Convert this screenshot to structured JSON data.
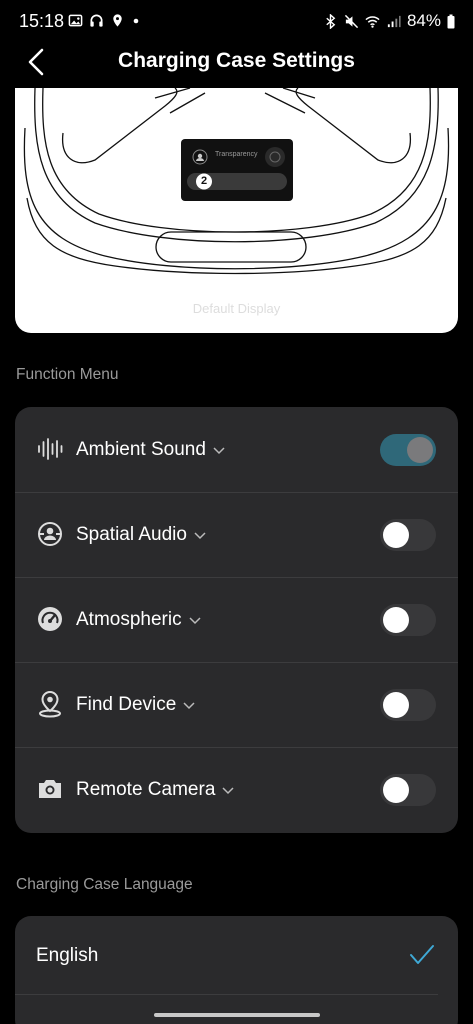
{
  "status_bar": {
    "time": "15:18",
    "battery": "84%"
  },
  "header": {
    "title": "Charging Case Settings"
  },
  "preview": {
    "screen_mode_label": "Transparency",
    "screen_badge": "2",
    "caption": "Default Display"
  },
  "function_menu": {
    "label": "Function Menu",
    "items": [
      {
        "label": "Ambient Sound",
        "icon": "waveform-icon",
        "enabled": true
      },
      {
        "label": "Spatial Audio",
        "icon": "spatial-audio-icon",
        "enabled": false
      },
      {
        "label": "Atmospheric",
        "icon": "gauge-icon",
        "enabled": false
      },
      {
        "label": "Find Device",
        "icon": "location-pin-icon",
        "enabled": false
      },
      {
        "label": "Remote Camera",
        "icon": "camera-icon",
        "enabled": false
      }
    ]
  },
  "language": {
    "label": "Charging Case Language",
    "selected": "English"
  },
  "colors": {
    "background": "#000000",
    "card": "#2a2a2c",
    "toggle_on": "#2f6879",
    "accent_check": "#3fa9d6"
  }
}
